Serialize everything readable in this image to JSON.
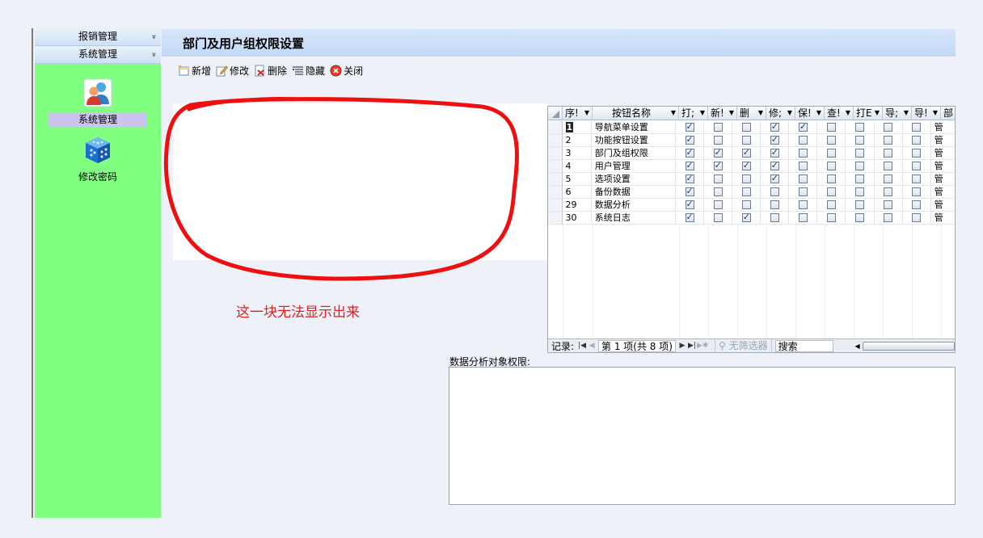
{
  "sidebar": {
    "sections": [
      {
        "label": "报销管理",
        "chevron": "»"
      },
      {
        "label": "系统管理",
        "chevron": "»"
      }
    ],
    "items": [
      {
        "label": "系统管理",
        "icon": "users-icon",
        "active": true
      },
      {
        "label": "修改密码",
        "icon": "cube-icon",
        "active": false
      }
    ]
  },
  "header": {
    "title": "部门及用户组权限设置"
  },
  "toolbar": {
    "add_label": "新增",
    "edit_label": "修改",
    "delete_label": "删除",
    "hide_label": "隐藏",
    "close_label": "关闭"
  },
  "annotation": {
    "text": "这一块无法显示出来"
  },
  "grid": {
    "columns": [
      "序!",
      "按钮名称",
      "打;",
      "新!",
      "删",
      "修;",
      "保!",
      "查!",
      "打E",
      "导;",
      "导!",
      "部"
    ],
    "rows": [
      {
        "id": "1",
        "name": "导航菜单设置",
        "checks": [
          1,
          0,
          0,
          1,
          1,
          0,
          0,
          0,
          0
        ],
        "dept": "管"
      },
      {
        "id": "2",
        "name": "功能按钮设置",
        "checks": [
          1,
          0,
          0,
          1,
          0,
          0,
          0,
          0,
          0
        ],
        "dept": "管"
      },
      {
        "id": "3",
        "name": "部门及组权限",
        "checks": [
          1,
          1,
          1,
          1,
          0,
          0,
          0,
          0,
          0
        ],
        "dept": "管"
      },
      {
        "id": "4",
        "name": "用户管理",
        "checks": [
          1,
          1,
          1,
          1,
          0,
          0,
          0,
          0,
          0
        ],
        "dept": "管"
      },
      {
        "id": "5",
        "name": "选项设置",
        "checks": [
          1,
          0,
          0,
          1,
          0,
          0,
          0,
          0,
          0
        ],
        "dept": "管"
      },
      {
        "id": "6",
        "name": "备份数据",
        "checks": [
          1,
          0,
          0,
          0,
          0,
          0,
          0,
          0,
          0
        ],
        "dept": "管"
      },
      {
        "id": "29",
        "name": "数据分析",
        "checks": [
          1,
          0,
          0,
          0,
          0,
          0,
          0,
          0,
          0
        ],
        "dept": "管"
      },
      {
        "id": "30",
        "name": "系统日志",
        "checks": [
          1,
          0,
          1,
          0,
          0,
          0,
          0,
          0,
          0
        ],
        "dept": "管"
      }
    ],
    "nav": {
      "label": "记录:",
      "position": "第 1 项(共 8 项)",
      "filter": "无筛选器",
      "search": "搜索"
    }
  },
  "perm": {
    "label": "数据分析对象权限:"
  },
  "colors": {
    "sidebar_bg": "#80ff80",
    "header_bg": "#c2d8f6",
    "annotation": "#e02020"
  }
}
